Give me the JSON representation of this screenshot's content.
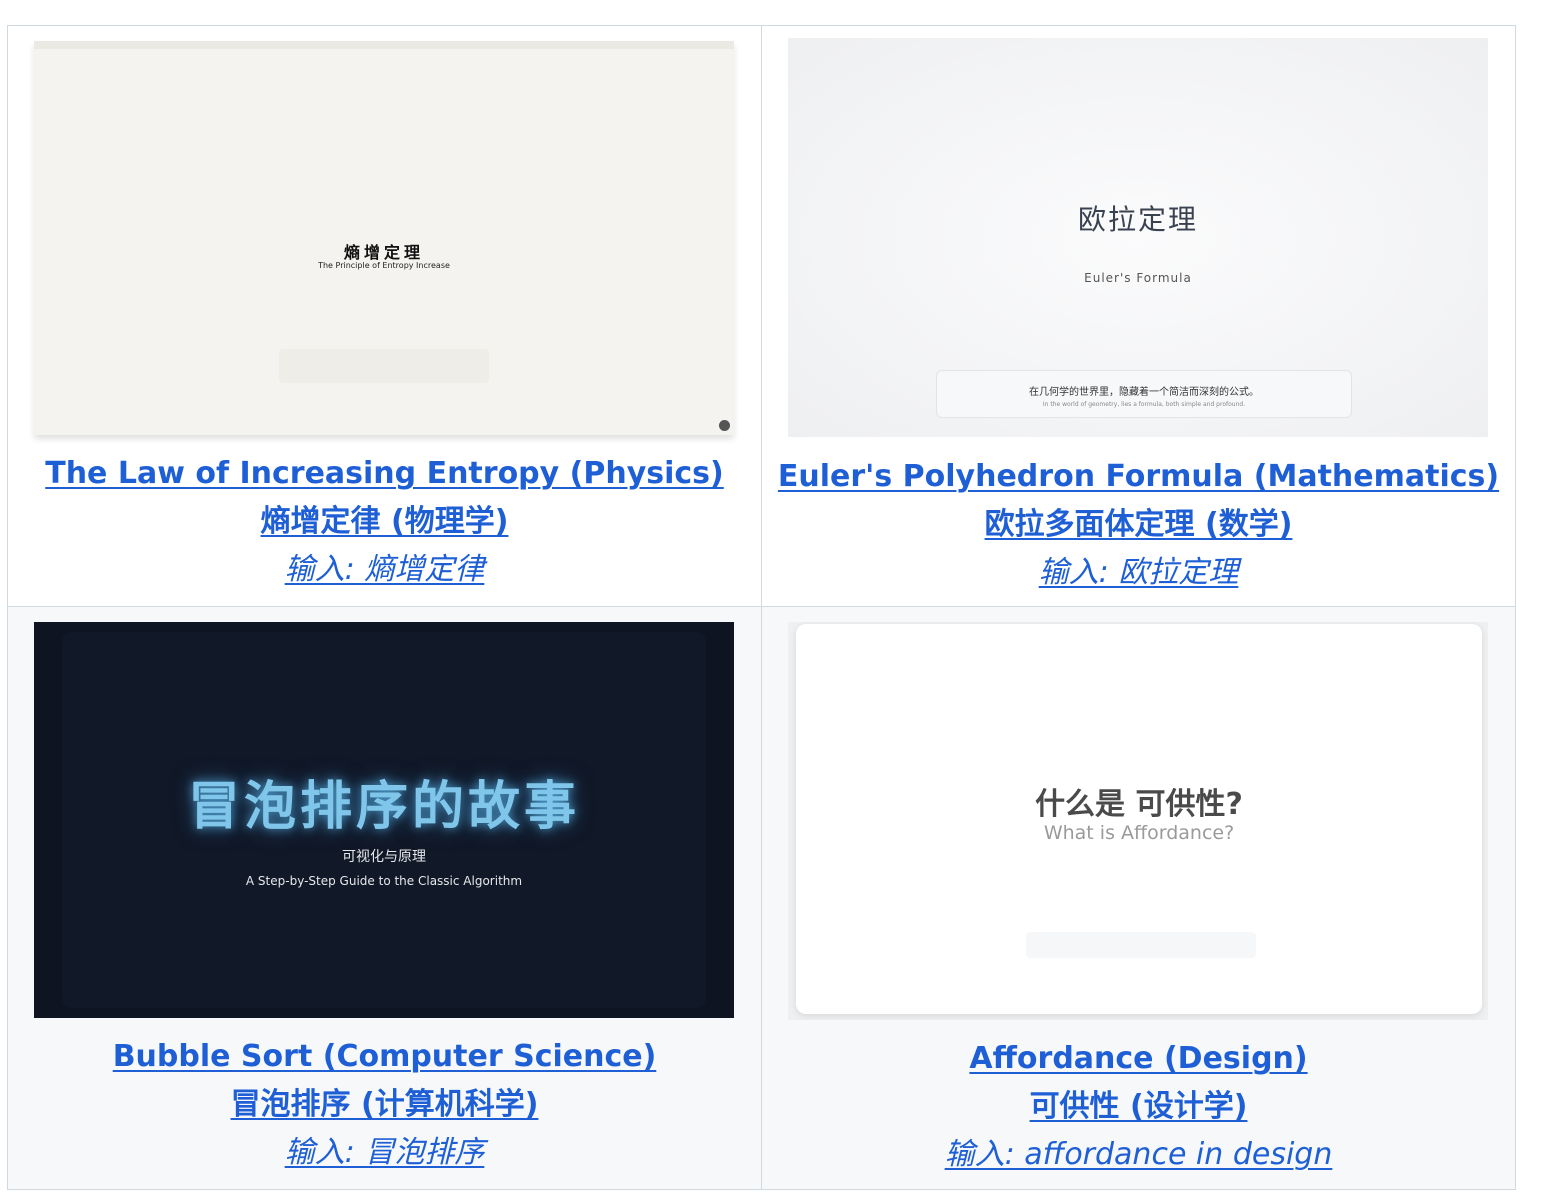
{
  "cards": [
    {
      "thumb": {
        "title": "熵增定理",
        "subtitle": "The Principle of Entropy Increase"
      },
      "title_en": "The Law of Increasing Entropy (Physics)",
      "title_zh": "熵增定律 (物理学)",
      "input": "输入: 熵增定律"
    },
    {
      "thumb": {
        "title": "欧拉定理",
        "subtitle": "Euler's Formula",
        "box_line1": "在几何学的世界里，隐藏着一个简洁而深刻的公式。",
        "box_line2": "In the world of geometry, lies a formula, both simple and profound."
      },
      "title_en": "Euler's Polyhedron Formula (Mathematics)",
      "title_zh": "欧拉多面体定理 (数学)",
      "input": "输入: 欧拉定理"
    },
    {
      "thumb": {
        "title": "冒泡排序的故事",
        "subtitle": "可视化与原理",
        "subtitle2": "A Step-by-Step Guide to the Classic Algorithm"
      },
      "title_en": "Bubble Sort (Computer Science)",
      "title_zh": "冒泡排序 (计算机科学)",
      "input": "输入: 冒泡排序"
    },
    {
      "thumb": {
        "title": "什么是 可供性?",
        "subtitle": "What is Affordance?"
      },
      "title_en": "Affordance (Design)",
      "title_zh": "可供性 (设计学)",
      "input": "输入: affordance in design"
    }
  ],
  "colors": {
    "link": "#1f5fd6",
    "border": "#d1d9e0",
    "alt_row": "#f6f8fa"
  }
}
